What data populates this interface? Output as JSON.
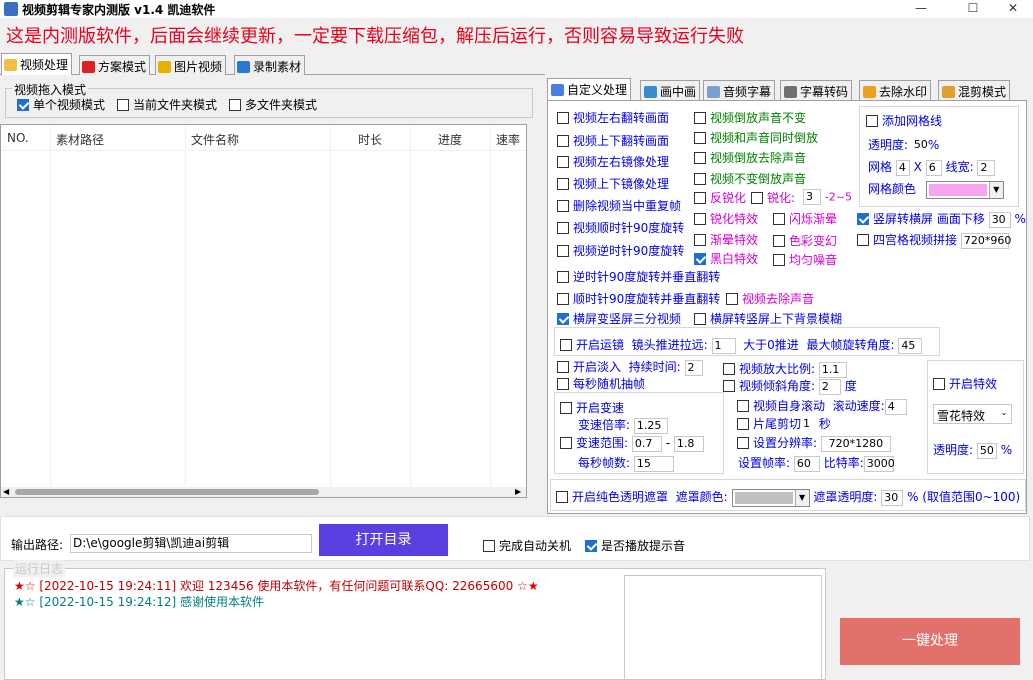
{
  "window": {
    "title": "视频剪辑专家内测版 v1.4 凯迪软件",
    "min_glyph": "—",
    "max_glyph": "☐",
    "close_glyph": "✕"
  },
  "banner": "这是内测版软件，后面会继续更新，一定要下载压缩包，解压后运行，否则容易导致运行失败",
  "main_tabs": [
    {
      "label": "视频处理",
      "icon": "folder-icon",
      "active": true
    },
    {
      "label": "方案模式",
      "icon": "flag-icon"
    },
    {
      "label": "图片视频",
      "icon": "music-icon"
    },
    {
      "label": "录制素材",
      "icon": "monitor-icon"
    }
  ],
  "drag_mode": {
    "legend": "视频拖入模式",
    "options": [
      {
        "label": "单个视频模式",
        "checked": true
      },
      {
        "label": "当前文件夹模式",
        "checked": false
      },
      {
        "label": "多文件夹模式",
        "checked": false
      }
    ]
  },
  "table": {
    "columns": [
      "NO.",
      "素材路径",
      "文件名称",
      "时长",
      "进度",
      "速率"
    ]
  },
  "right_tabs": [
    {
      "label": "自定义处理",
      "active": true
    },
    {
      "label": "画中画"
    },
    {
      "label": "音频字幕"
    },
    {
      "label": "字幕转码"
    },
    {
      "label": "去除水印"
    },
    {
      "label": "混剪模式"
    }
  ],
  "custom": {
    "col1": [
      {
        "label": "视频左右翻转画面",
        "checked": false
      },
      {
        "label": "视频上下翻转画面",
        "checked": false
      },
      {
        "label": "视频左右镜像处理",
        "checked": false
      },
      {
        "label": "视频上下镜像处理",
        "checked": false
      },
      {
        "label": "删除视频当中重复帧",
        "checked": false
      },
      {
        "label": "视频顺时针90度旋转",
        "checked": false
      },
      {
        "label": "视频逆时针90度旋转",
        "checked": false
      },
      {
        "label": "逆时针90度旋转并垂直翻转",
        "checked": false
      },
      {
        "label": "顺时针90度旋转并垂直翻转",
        "checked": false
      },
      {
        "label": "横屏变竖屏三分视频",
        "checked": true
      }
    ],
    "col2": [
      {
        "label": "视频倒放声音不变",
        "checked": false
      },
      {
        "label": "视频和声音同时倒放",
        "checked": false
      },
      {
        "label": "视频倒放去除声音",
        "checked": false
      },
      {
        "label": "视频不变倒放声音",
        "checked": false
      }
    ],
    "anti_sharpen": "反锐化",
    "sharpen": "锐化:",
    "sharpen_value": "3",
    "sharpen_range": "-2~5",
    "effects_left": [
      {
        "label": "锐化特效",
        "checked": false
      },
      {
        "label": "渐晕特效",
        "checked": false
      },
      {
        "label": "黑白特效",
        "checked": true
      }
    ],
    "effects_right": [
      {
        "label": "闪烁渐晕",
        "checked": false
      },
      {
        "label": "色彩变幻",
        "checked": false
      },
      {
        "label": "均匀噪音",
        "checked": false
      }
    ],
    "remove_audio": "视频去除声音",
    "landscape_blur": "横屏转竖屏上下背景模糊",
    "grid": {
      "label": "添加网格线",
      "opacity_label": "透明度:",
      "opacity_value": "50",
      "opacity_unit": "%",
      "grid_label": "网格",
      "grid_a": "4",
      "grid_x": "X",
      "grid_b": "6",
      "line_width_label": "线宽:",
      "line_width": "2",
      "grid_color_label": "网格颜色",
      "grid_color": "#f6a6f0"
    },
    "vertical": {
      "label": "竖屏转横屏",
      "checked": true,
      "move_label": "画面下移",
      "move_value": "30",
      "move_unit": "%"
    },
    "four_grid": {
      "label": "四宫格视频拼接",
      "value": "720*960"
    },
    "mirror_move": {
      "label": "开启运镜",
      "push_label": "镜头推进拉远:",
      "push_value": "1",
      "hint": "大于0推进",
      "max_angle_label": "最大帧旋转角度:",
      "max_angle": "45"
    },
    "fade": {
      "label": "开启淡入",
      "duration_label": "持续时间:",
      "duration": "2",
      "random_frames": "每秒随机抽帧"
    },
    "scale": {
      "zoom_label": "视频放大比例:",
      "zoom": "1.1",
      "tilt_label": "视频倾斜角度:",
      "tilt": "2",
      "tilt_unit": "度"
    },
    "effects_panel": {
      "label": "开启特效",
      "select": "雪花特效",
      "opacity_label": "透明度:",
      "opacity": "50",
      "unit": "%"
    },
    "speed": {
      "label": "开启变速",
      "rate_label": "变速倍率:",
      "rate": "1.25",
      "range_label": "变速范围:",
      "range_a": "0.7",
      "range_dash": "-",
      "range_b": "1.8",
      "fps_label": "每秒帧数:",
      "fps": "15"
    },
    "scroll": {
      "label": "视频自身滚动",
      "speed_label": "滚动速度:",
      "speed": "4",
      "cut_label": "片尾剪切",
      "cut": "1",
      "cut_unit": "秒",
      "res_label": "设置分辨率:",
      "res": "720*1280",
      "fps_label": "设置帧率:",
      "fps": "60",
      "bitrate_label": "比特率:",
      "bitrate": "3000"
    },
    "mask": {
      "label": "开启纯色透明遮罩",
      "color_label": "遮罩颜色:",
      "color": "#c0c0c0",
      "opacity_label": "遮罩透明度:",
      "opacity": "30",
      "hint": "% (取值范围0~100)"
    }
  },
  "output": {
    "label": "输出路径:",
    "path": "D:\\e\\google剪辑\\凯迪ai剪辑",
    "open_button": "打开目录",
    "auto_shutdown": "完成自动关机",
    "play_sound": "是否播放提示音"
  },
  "log": {
    "legend": "运行日志",
    "lines": [
      "[2022-10-15 19:24:11] 欢迎 123456 使用本软件，有任何问题可联系QQ: 22665600",
      "[2022-10-15 19:24:12] 感谢使用本软件"
    ]
  },
  "process_button": "一键处理"
}
